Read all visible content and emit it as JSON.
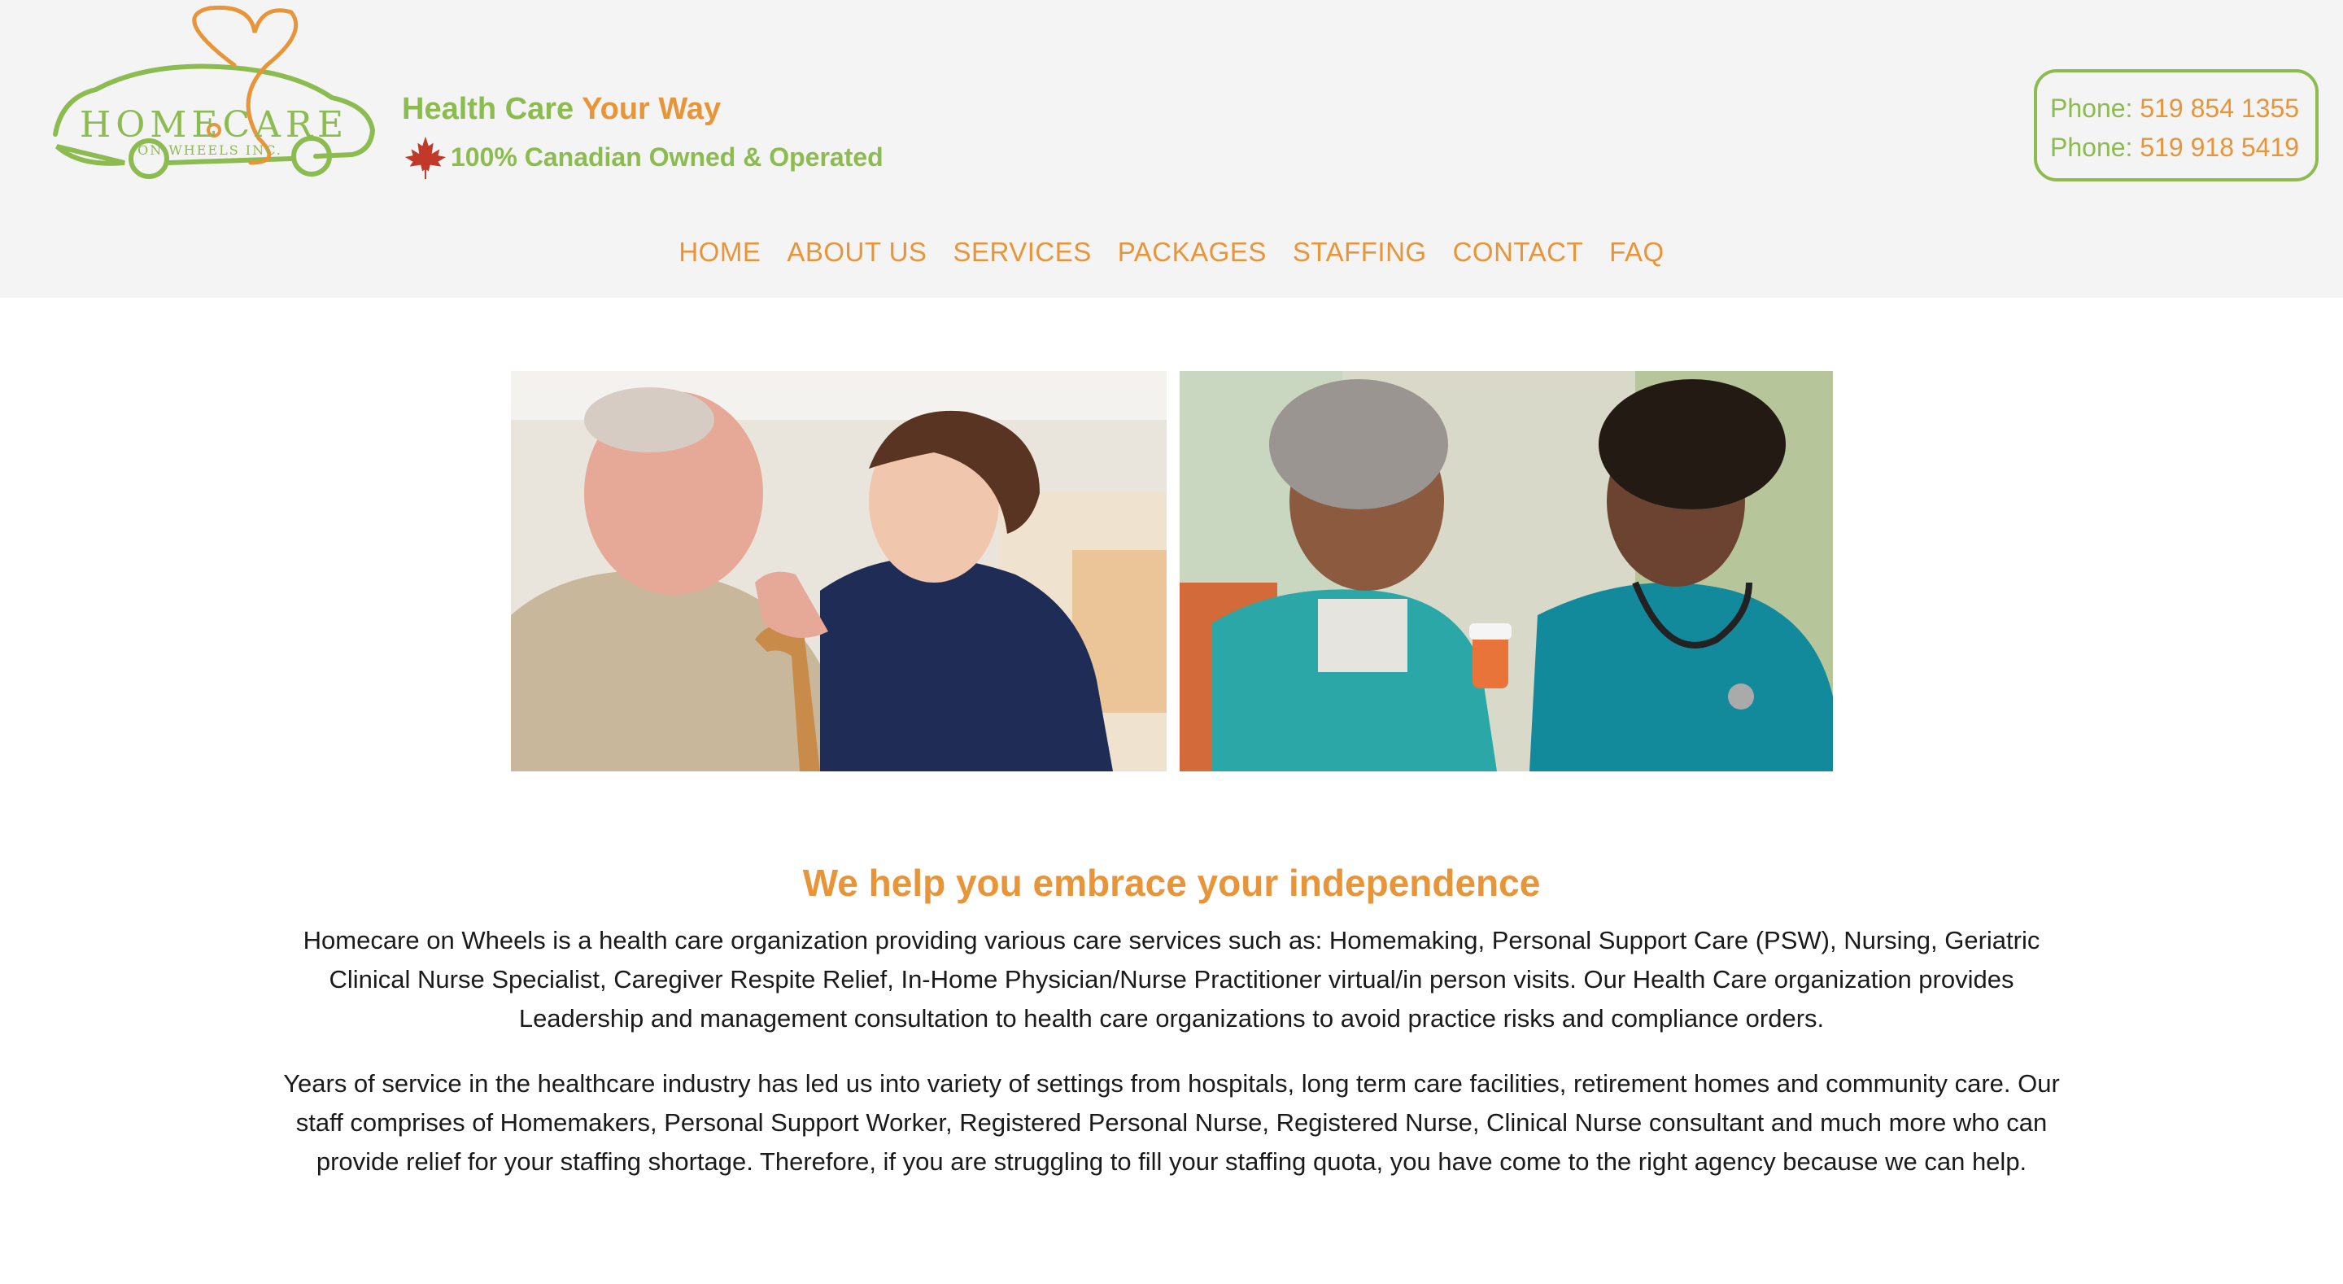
{
  "logo": {
    "text_main": "HOMECARE",
    "text_sub": "ON WHEELS  INC."
  },
  "tagline": {
    "part1": "Health Care",
    "part2": "Your Way",
    "sub": "100% Canadian Owned & Operated"
  },
  "phones": [
    {
      "label": "Phone:",
      "number": "519 854 1355"
    },
    {
      "label": "Phone:",
      "number": "519 918 5419"
    }
  ],
  "nav": [
    "HOME",
    "ABOUT US",
    "SERVICES",
    "PACKAGES",
    "STAFFING",
    "CONTACT",
    "FAQ"
  ],
  "content": {
    "headline": "We help you embrace your independence",
    "paragraphs": [
      "Homecare on Wheels is a health care organization providing various care services such as: Homemaking, Personal Support Care (PSW), Nursing, Geriatric Clinical Nurse Specialist, Caregiver Respite Relief, In-Home Physician/Nurse Practitioner virtual/in person visits. Our Health Care organization provides Leadership and management consultation to health care organizations to avoid practice risks and compliance orders.",
      "Years of service in the healthcare industry has led us into variety of settings from hospitals, long term care facilities, retirement homes and community care.  Our staff comprises of Homemakers, Personal Support Worker, Registered Personal Nurse, Registered Nurse, Clinical Nurse consultant and much more who can provide relief for your staffing shortage.  Therefore, if you are struggling to fill your staffing quota, you have come to the right agency because we can help."
    ]
  },
  "colors": {
    "brand_green": "#8cbb4f",
    "brand_orange": "#e8953a",
    "header_bg": "#f4f4f4"
  },
  "icons": [
    "maple-leaf-icon"
  ]
}
